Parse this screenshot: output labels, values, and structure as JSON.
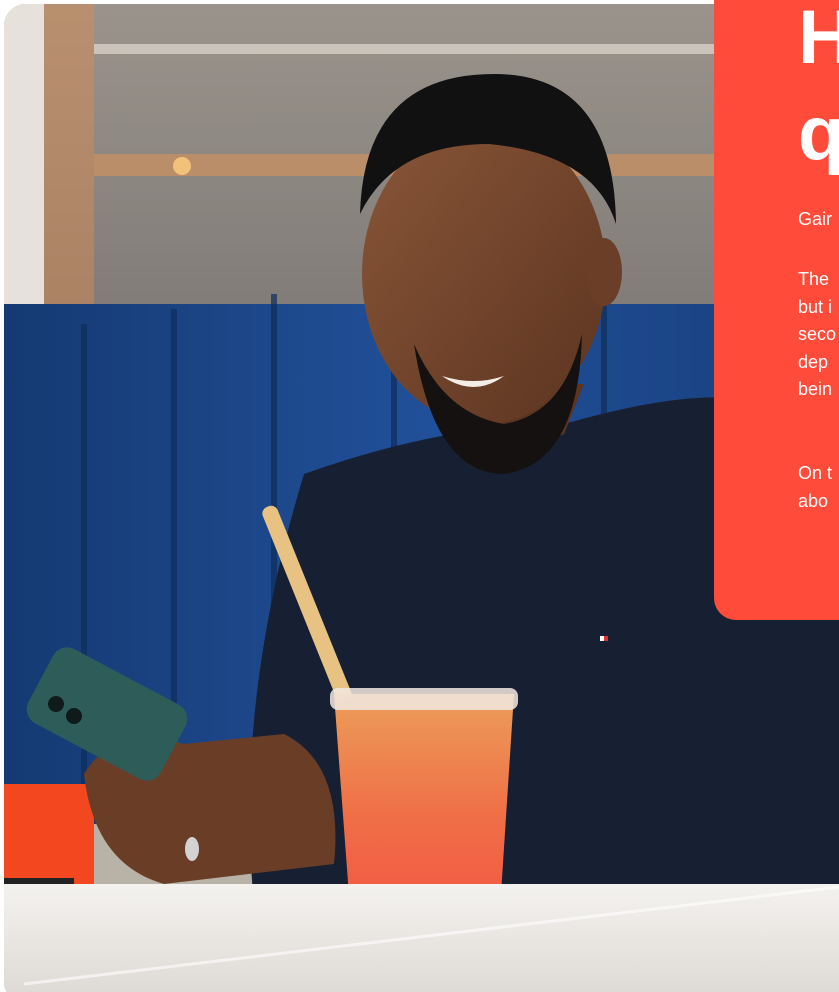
{
  "callout": {
    "headline": "H\nq",
    "paragraphs": [
      "Gair",
      "The\nbut i\nseco\ndep\nbein",
      "On t\nabo"
    ]
  },
  "photo": {
    "description_icon": "person-at-cafe-photo"
  },
  "colors": {
    "accent": "#ff4b3a",
    "card_text": "#ffffff",
    "booth_blue": "#1f4a8c",
    "sweater_navy": "#172033",
    "drink_orange": "#fb7a4f"
  }
}
